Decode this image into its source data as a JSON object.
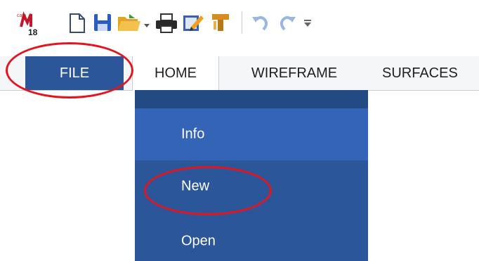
{
  "quick_access": {
    "logo_text": "18",
    "icons": [
      "app-logo-icon",
      "new-document-icon",
      "save-icon",
      "open-folder-icon",
      "dropdown-arrow-icon",
      "print-icon",
      "edit-icon",
      "properties-icon",
      "undo-icon",
      "redo-icon",
      "customize-toolbar-icon"
    ]
  },
  "ribbon": {
    "tabs": [
      {
        "label": "FILE"
      },
      {
        "label": "HOME"
      },
      {
        "label": "WIREFRAME"
      },
      {
        "label": "SURFACES"
      }
    ]
  },
  "file_menu": {
    "items": [
      {
        "label": "Info"
      },
      {
        "label": "New"
      },
      {
        "label": "Open"
      }
    ]
  },
  "colors": {
    "file_blue": "#2b579a",
    "info_highlight": "#3464b6",
    "annotation_red": "#e3161f"
  }
}
